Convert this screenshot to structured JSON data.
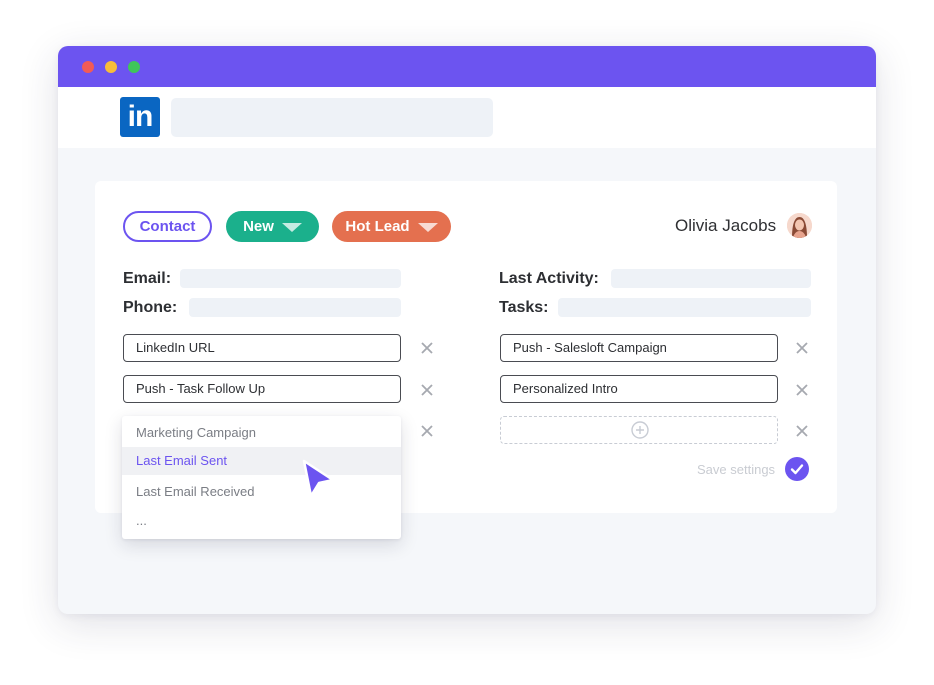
{
  "window": {
    "controls": [
      "close",
      "minimize",
      "maximize"
    ]
  },
  "app": {
    "logo_text": "in",
    "logo_icon": "linkedin-icon"
  },
  "header": {
    "contact_label": "Contact",
    "new_label": "New",
    "hot_lead_label": "Hot Lead",
    "user_name": "Olivia Jacobs"
  },
  "left_fields": {
    "email_label": "Email:",
    "phone_label": "Phone:"
  },
  "right_fields": {
    "last_activity_label": "Last Activity:",
    "tasks_label": "Tasks:"
  },
  "left_inputs": [
    "LinkedIn URL",
    "Push - Task Follow Up"
  ],
  "right_inputs": [
    "Push - Salesloft Campaign",
    "Personalized Intro"
  ],
  "dropdown": {
    "items": [
      "Marketing Campaign",
      "Last Email Sent",
      "Last Email Received",
      "..."
    ],
    "selected": "Last Email Sent"
  },
  "footer": {
    "save_label": "Save settings"
  },
  "colors": {
    "accent": "#6c54f0",
    "new_status": "#1bb08c",
    "hot_lead": "#e4704f",
    "linkedin": "#0a66c2"
  }
}
